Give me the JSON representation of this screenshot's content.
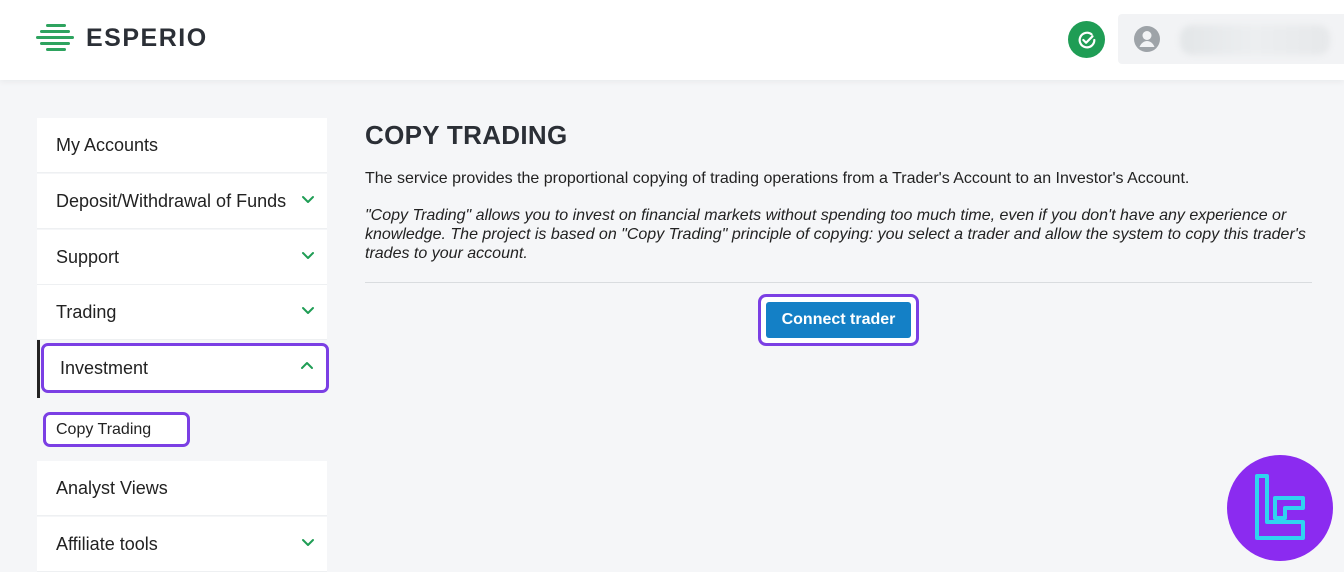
{
  "brand": {
    "name": "ESPERIO"
  },
  "header": {
    "verified_icon": "check-circle-icon",
    "user_icon": "user-avatar-icon"
  },
  "sidebar": {
    "items": [
      {
        "label": "My Accounts",
        "expandable": false
      },
      {
        "label": "Deposit/Withdrawal of Funds",
        "expandable": true
      },
      {
        "label": "Support",
        "expandable": true
      },
      {
        "label": "Trading",
        "expandable": true
      },
      {
        "label": "Investment",
        "expandable": true,
        "expanded": true
      },
      {
        "label": "Analyst Views",
        "expandable": false
      },
      {
        "label": "Affiliate tools",
        "expandable": true
      }
    ],
    "submenu": [
      {
        "label": "Copy Trading"
      }
    ]
  },
  "main": {
    "title": "COPY TRADING",
    "description": "The service provides the proportional copying of trading operations from a Trader's Account to an Investor's Account.",
    "note": "\"Copy Trading\" allows you to invest on financial markets without spending too much time, even if you don't have any experience or knowledge. The project is based on \"Copy Trading\" principle of copying: you select a trader and allow the system to copy this trader's trades to your account.",
    "connect_label": "Connect trader"
  },
  "colors": {
    "accent_green": "#1f9d55",
    "button_blue": "#1480c6",
    "highlight_purple": "#7b3fe4"
  }
}
